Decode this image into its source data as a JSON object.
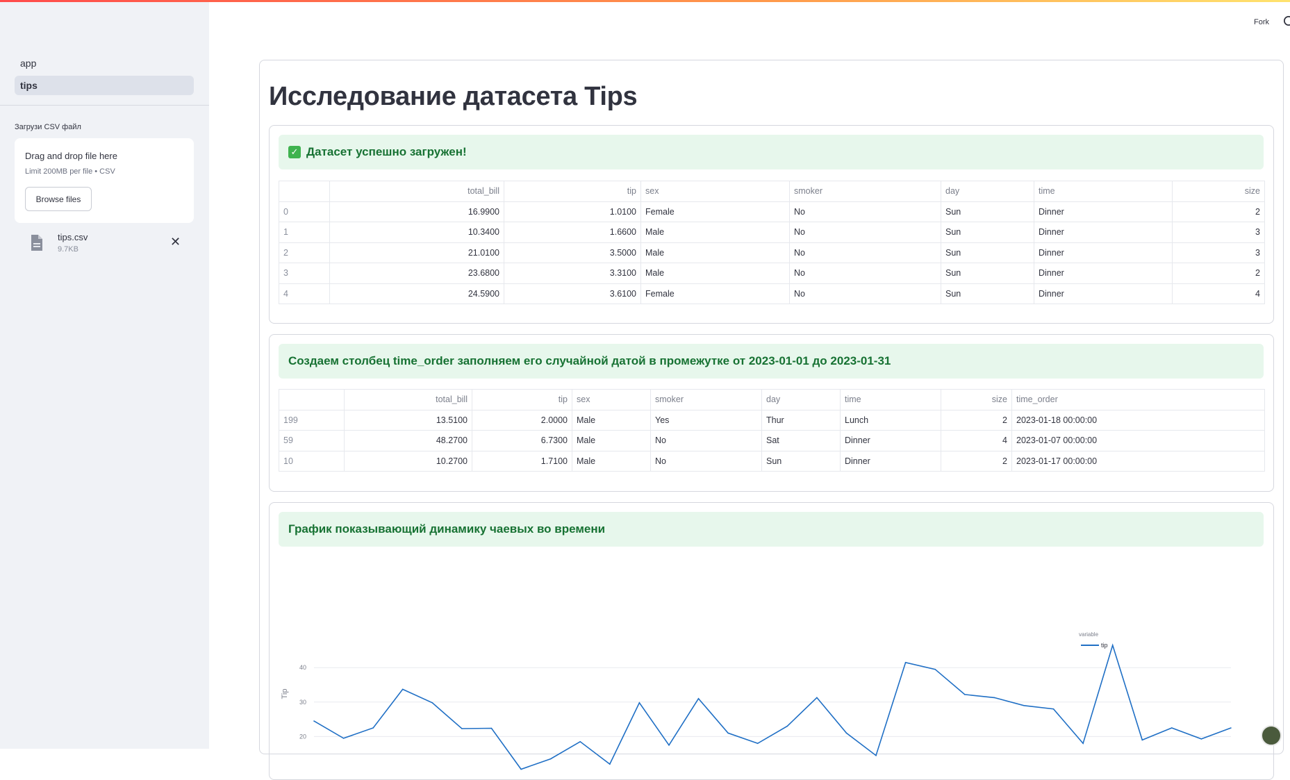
{
  "sidebar": {
    "nav": [
      {
        "label": "app",
        "active": false
      },
      {
        "label": "tips",
        "active": true
      }
    ],
    "upload_label": "Загрузи CSV файл",
    "dropzone_title": "Drag and drop file here",
    "dropzone_limit": "Limit 200MB per file • CSV",
    "browse_label": "Browse files",
    "file": {
      "name": "tips.csv",
      "size": "9.7KB",
      "icon": "file-icon"
    }
  },
  "header": {
    "fork_label": "Fork",
    "github_icon": "github-icon"
  },
  "main": {
    "title": "Исследование датасета Tips",
    "success_banner": "Датасет успешно загружен!",
    "table1": {
      "columns": [
        "",
        "total_bill",
        "tip",
        "sex",
        "smoker",
        "day",
        "time",
        "size"
      ],
      "rows": [
        [
          "0",
          "16.9900",
          "1.0100",
          "Female",
          "No",
          "Sun",
          "Dinner",
          "2"
        ],
        [
          "1",
          "10.3400",
          "1.6600",
          "Male",
          "No",
          "Sun",
          "Dinner",
          "3"
        ],
        [
          "2",
          "21.0100",
          "3.5000",
          "Male",
          "No",
          "Sun",
          "Dinner",
          "3"
        ],
        [
          "3",
          "23.6800",
          "3.3100",
          "Male",
          "No",
          "Sun",
          "Dinner",
          "2"
        ],
        [
          "4",
          "24.5900",
          "3.6100",
          "Female",
          "No",
          "Sun",
          "Dinner",
          "4"
        ]
      ]
    },
    "info_banner_2": "Создаем столбец time_order заполняем его случайной датой в промежутке от 2023-01-01 до 2023-01-31",
    "table2": {
      "columns": [
        "",
        "total_bill",
        "tip",
        "sex",
        "smoker",
        "day",
        "time",
        "size",
        "time_order"
      ],
      "rows": [
        [
          "199",
          "13.5100",
          "2.0000",
          "Male",
          "Yes",
          "Thur",
          "Lunch",
          "2",
          "2023-01-18 00:00:00"
        ],
        [
          "59",
          "48.2700",
          "6.7300",
          "Male",
          "No",
          "Sat",
          "Dinner",
          "4",
          "2023-01-07 00:00:00"
        ],
        [
          "10",
          "10.2700",
          "1.7100",
          "Male",
          "No",
          "Sun",
          "Dinner",
          "2",
          "2023-01-17 00:00:00"
        ]
      ]
    },
    "info_banner_3": "График показывающий динамику чаевых во времени"
  },
  "chart_data": {
    "type": "line",
    "ylabel": "Tip",
    "yticks": [
      20,
      30,
      40
    ],
    "legend_title": "variable",
    "legend_position": "top-right",
    "color": "#1f6fc5",
    "series": [
      {
        "name": "tip",
        "values": [
          24.5,
          19.5,
          22.5,
          33.7,
          29.8,
          22.3,
          22.4,
          10.5,
          13.5,
          18.5,
          12.0,
          29.8,
          17.5,
          31.0,
          21.0,
          18.0,
          23.0,
          31.3,
          21.0,
          14.5,
          41.5,
          39.5,
          32.2,
          31.3,
          29.0,
          28.0,
          18.0,
          46.5,
          19.0,
          22.5,
          19.3,
          22.5
        ]
      }
    ]
  }
}
